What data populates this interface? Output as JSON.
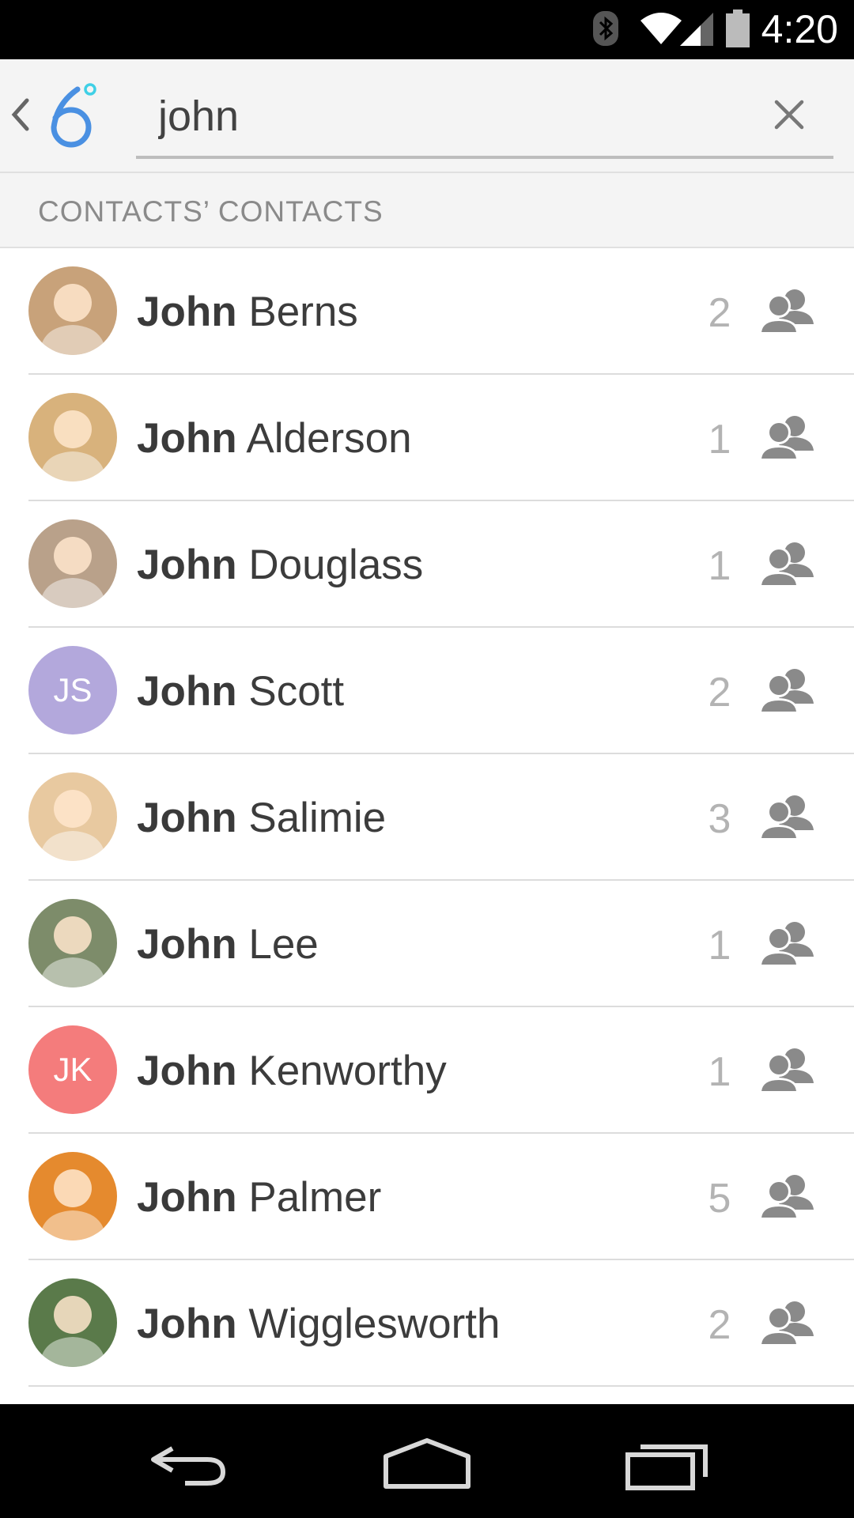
{
  "status_bar": {
    "time": "4:20"
  },
  "search": {
    "value": "john",
    "placeholder": ""
  },
  "section": {
    "title": "CONTACTS’ CONTACTS"
  },
  "contacts": [
    {
      "first": "John",
      "last": "Berns",
      "count": "2",
      "avatar": "photo",
      "color": "#c8a27a"
    },
    {
      "first": "John",
      "last": "Alderson",
      "count": "1",
      "avatar": "photo",
      "color": "#d8b27c"
    },
    {
      "first": "John",
      "last": "Douglass",
      "count": "1",
      "avatar": "photo",
      "color": "#b9a18a"
    },
    {
      "first": "John",
      "last": "Scott",
      "count": "2",
      "avatar": "initials",
      "initials": "JS",
      "color": "#b3a8dc"
    },
    {
      "first": "John",
      "last": "Salimie",
      "count": "3",
      "avatar": "photo",
      "color": "#e8c9a0"
    },
    {
      "first": "John",
      "last": "Lee",
      "count": "1",
      "avatar": "photo",
      "color": "#7d8c6a"
    },
    {
      "first": "John",
      "last": "Kenworthy",
      "count": "1",
      "avatar": "initials",
      "initials": "JK",
      "color": "#f47c7c"
    },
    {
      "first": "John",
      "last": "Palmer",
      "count": "5",
      "avatar": "photo",
      "color": "#e58a2e"
    },
    {
      "first": "John",
      "last": "Wigglesworth",
      "count": "2",
      "avatar": "photo",
      "color": "#5a7a4a"
    }
  ],
  "colors": {
    "logo_blue": "#4a90e2",
    "logo_cyan": "#3fd0e6",
    "icon_gray": "#8a8a8a"
  }
}
